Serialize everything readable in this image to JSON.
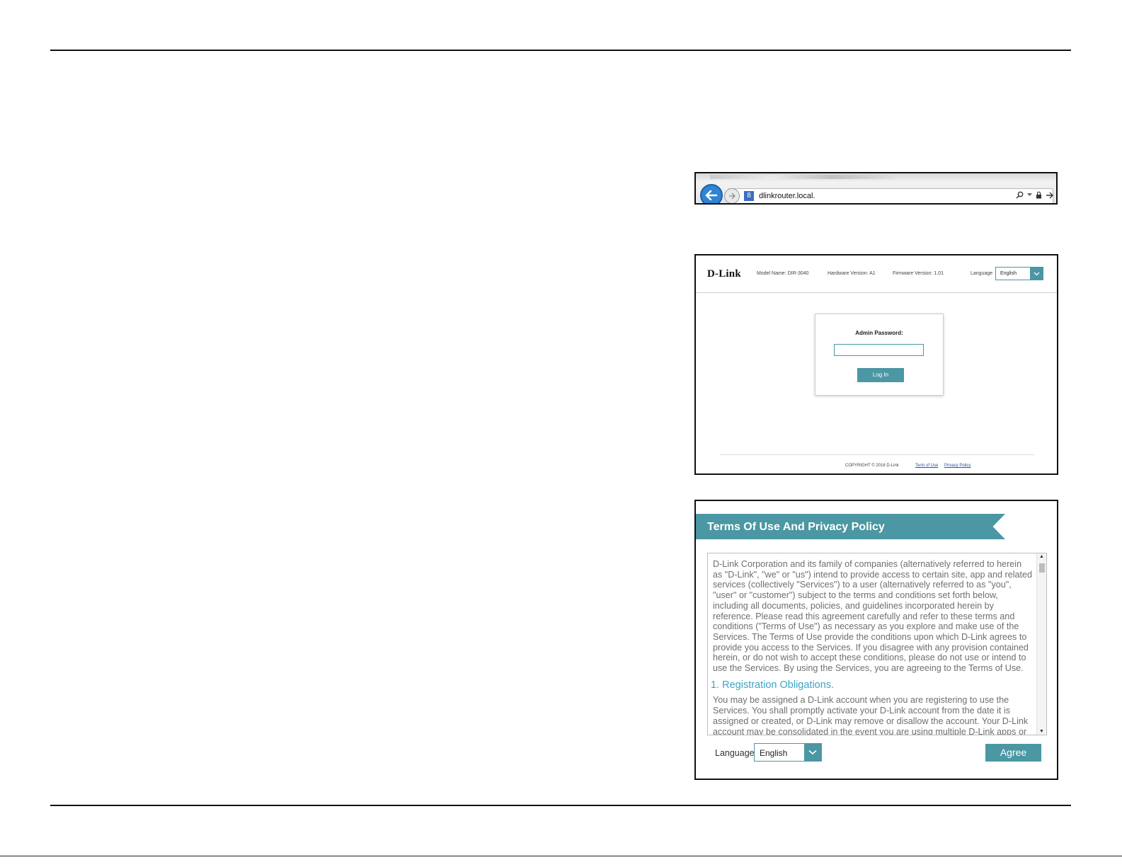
{
  "browser": {
    "url": "dlinkrouter.local.",
    "site_icon_glyph": "8",
    "address_icons": [
      "search-icon",
      "dropdown-icon",
      "lock-icon",
      "go-icon"
    ]
  },
  "login_page": {
    "logo": "D-Link",
    "model_name": "Model Name: DIR-3040",
    "hardware_version": "Hardware Version: A1",
    "firmware_version": "Firmware Version: 1.01",
    "language_label": "Language",
    "language_value": "English",
    "admin_password_label": "Admin Password:",
    "login_button": "Log In",
    "copyright": "COPYRIGHT © 2016 D-Link",
    "terms_link": "Term of Use",
    "privacy_link": "Privacy Policy"
  },
  "terms_dialog": {
    "title": "Terms Of Use And Privacy Policy",
    "intro_text": "D-Link Corporation and its family of companies (alternatively referred to herein as \"D-Link\", \"we\" or \"us\") intend to provide access to certain site, app and related services (collectively \"Services\") to a user (alternatively referred to as \"you\", \"user\" or \"customer\") subject to the terms and conditions set forth below, including all documents, policies, and guidelines incorporated herein by reference. Please read this agreement carefully and refer to these terms and conditions (\"Terms of Use\") as necessary as you explore and make use of the Services. The Terms of Use provide the conditions upon which D-Link agrees to provide you access to the Services. If you disagree with any provision contained herein, or do not wish to accept these conditions, please do not use or intend to use the Services. By using the Services, you are agreeing to the Terms of Use.",
    "section_heading": "1. Registration Obligations.",
    "section_text": "You may be assigned a D-Link account when you are registering to use the Services. You shall promptly activate your D-Link account from the date it is assigned or created, or D-Link may remove or disallow the account. Your D-Link account may be consolidated in the event you are using multiple D-Link apps or",
    "language_label": "Language:",
    "language_value": "English",
    "agree_button": "Agree"
  },
  "colors": {
    "accent": "#4b97a3",
    "heading_blue": "#3ea4c6",
    "browser_back": "#2f84d3"
  }
}
